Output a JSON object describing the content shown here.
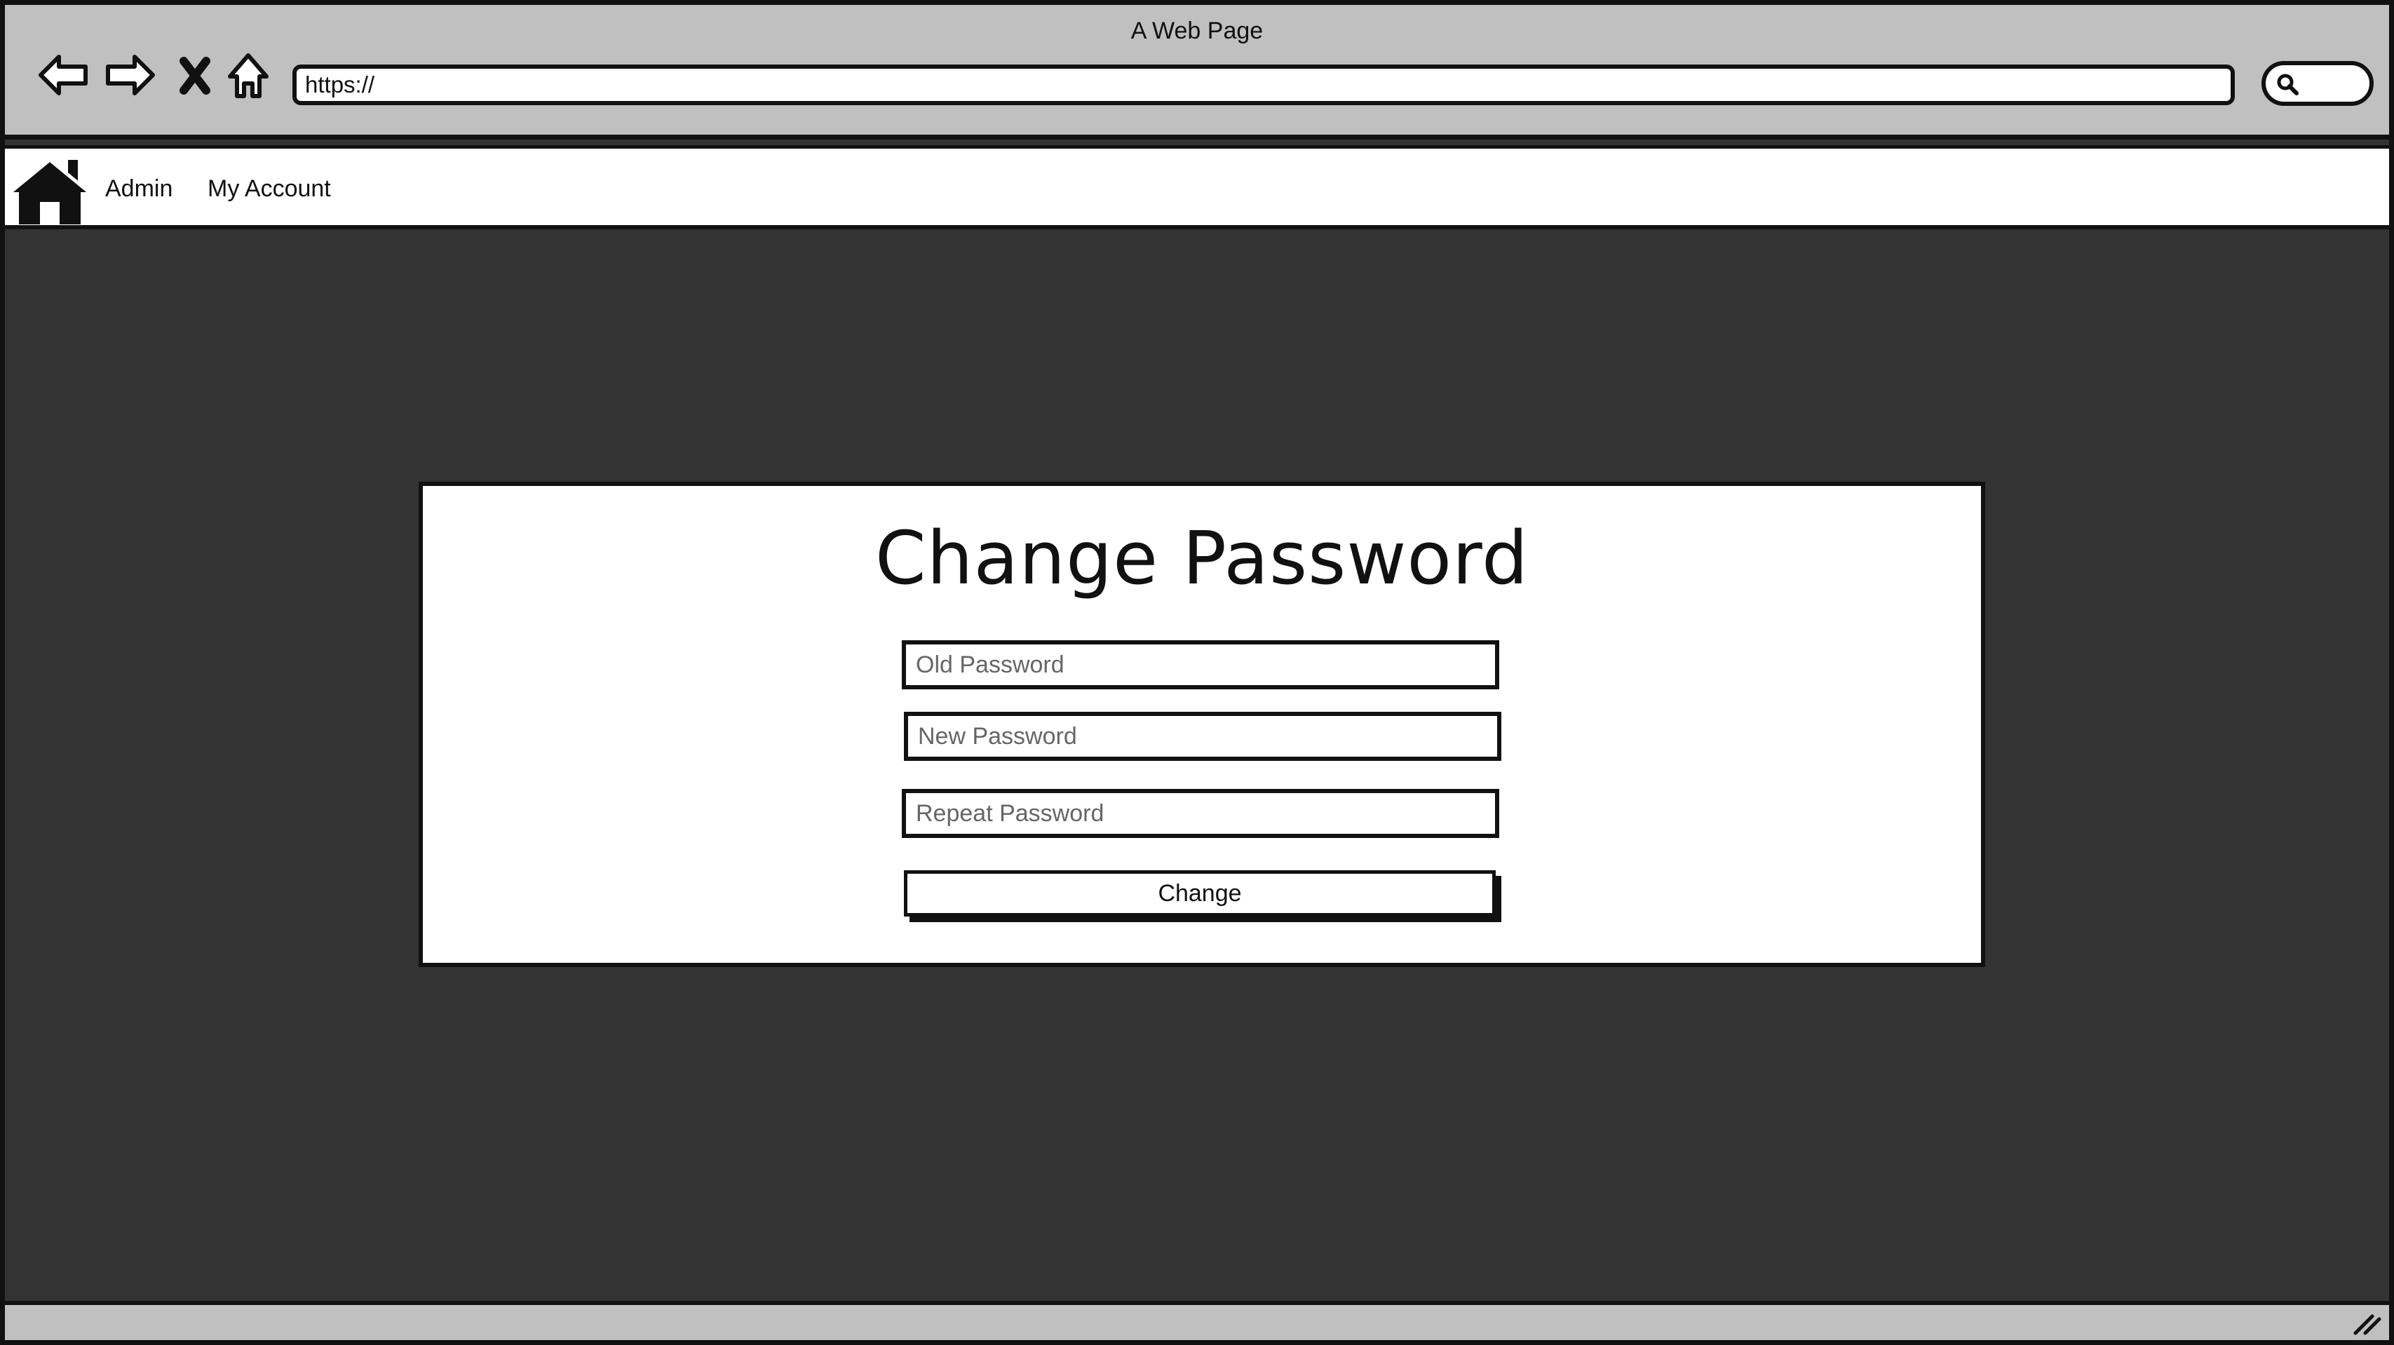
{
  "browser": {
    "window_title": "A Web Page",
    "address": "https://",
    "back_icon": "arrow-left-icon",
    "forward_icon": "arrow-right-icon",
    "stop_icon": "close-icon",
    "home_icon": "home-outline-icon",
    "search_icon": "search-icon"
  },
  "navbar": {
    "home_icon": "home-icon",
    "links": [
      {
        "label": "Admin"
      },
      {
        "label": "My Account"
      }
    ]
  },
  "form": {
    "title": "Change Password",
    "old_password_placeholder": "Old Password",
    "new_password_placeholder": "New Password",
    "repeat_password_placeholder": "Repeat Password",
    "submit_label": "Change"
  },
  "colors": {
    "page_background": "#333333",
    "chrome": "#c0c0c0",
    "outline": "#111111"
  }
}
